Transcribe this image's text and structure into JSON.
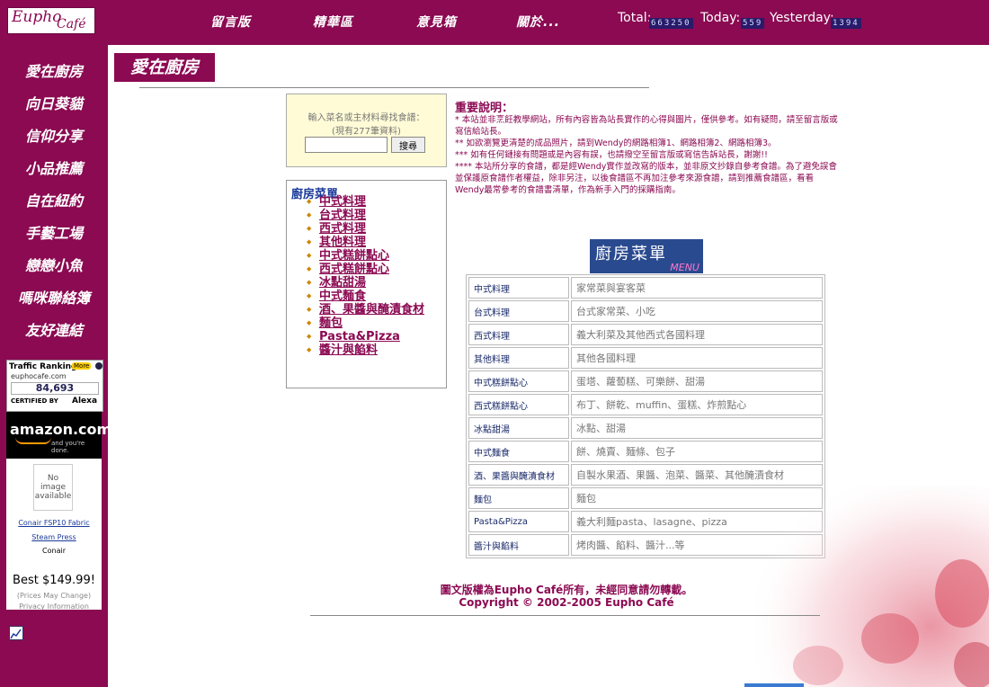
{
  "header": {
    "logo": {
      "line1": "Eupho",
      "line2": "Café"
    },
    "nav": [
      {
        "label": "留言版"
      },
      {
        "label": "精華區"
      },
      {
        "label": "意見箱"
      },
      {
        "label": "關於..."
      }
    ],
    "stats": {
      "total_label": "Total:",
      "total_value": "663250",
      "today_label": "Today:",
      "today_value": "559",
      "yesterday_label": "Yesterday:",
      "yesterday_value": "1394"
    }
  },
  "sidebar": {
    "items": [
      {
        "label": "愛在廚房"
      },
      {
        "label": "向日葵貓"
      },
      {
        "label": "信仰分享"
      },
      {
        "label": "小品推薦"
      },
      {
        "label": "自在紐約"
      },
      {
        "label": "手藝工場"
      },
      {
        "label": "戀戀小魚"
      },
      {
        "label": "嗎咪聯絡簿"
      },
      {
        "label": "友好連結"
      }
    ],
    "traffic": {
      "title": "Traffic Ranking",
      "more": "More",
      "domain": "euphocafe.com",
      "rank": "84,693",
      "certified": "CERTIFIED BY",
      "brand": "Alexa"
    },
    "amazon": {
      "brand": "amazon.com",
      "tagline": "and you're done."
    },
    "product": {
      "noimage": "No image available",
      "name": "Conair FSP10 Fabric Steam Press",
      "maker": "Conair",
      "price": "Best $149.99!",
      "note": "(Prices May Change)",
      "privacy": "Privacy Information"
    }
  },
  "page_title": "愛在廚房",
  "search": {
    "prompt": "輸入菜名或主材料尋找食譜：",
    "count": "(現有277筆資料)",
    "value": "",
    "button": "搜尋"
  },
  "kitchen_menu": {
    "title": "廚房菜單",
    "items": [
      "中式料理",
      "台式料理",
      "西式料理",
      "其他料理",
      "中式糕餅點心",
      "西式糕餅點心",
      "冰點甜湯",
      "中式麵食",
      "酒、果醬與醃漬食材",
      "麵包",
      "Pasta&Pizza",
      "醬汁與餡料"
    ]
  },
  "notice": {
    "title": "重要說明：",
    "p1": "* 本站並非烹飪教學網站，所有內容皆為站長實作的心得與圖片，僅供參考。如有疑問，請至留言版或寫信給站長。",
    "p2": "** 如欲瀏覽更清楚的成品照片，請到Wendy的網路相簿1、網路相簿2、網路相簿3。",
    "p3": "*** 如有任何鏈接有問題或是內容有誤，也請撥空至留言版或寫信告訴站長，謝謝!!",
    "p4": "**** 本站所分享的食譜，都是經Wendy實作並改寫的版本，並非原文抄錄自參考食譜。為了避免誤會並保護原食譜作者權益，除非另注，以後食譜區不再加注參考來源食譜，請到推薦食譜區，看看Wendy最常參考的食譜書清單，作為新手入門的採購指南。"
  },
  "banner": {
    "text": "廚房菜單",
    "sub": "MENU"
  },
  "menu_table": [
    {
      "cat": "中式料理",
      "desc": "家常菜與宴客菜"
    },
    {
      "cat": "台式料理",
      "desc": "台式家常菜、小吃"
    },
    {
      "cat": "西式料理",
      "desc": "義大利菜及其他西式各國料理"
    },
    {
      "cat": "其他料理",
      "desc": "其他各國料理"
    },
    {
      "cat": "中式糕餅點心",
      "desc": "蛋塔、蘿蔔糕、可樂餅、甜湯"
    },
    {
      "cat": "西式糕餅點心",
      "desc": "布丁、餅乾、muffin、蛋糕、炸煎點心"
    },
    {
      "cat": "冰點甜湯",
      "desc": "冰點、甜湯"
    },
    {
      "cat": "中式麵食",
      "desc": "餅、燒賣、麵條、包子"
    },
    {
      "cat": "酒、果醬與醃漬食材",
      "desc": "自製水果酒、果醬、泡菜、醬菜、其他醃漬食材"
    },
    {
      "cat": "麵包",
      "desc": "麵包"
    },
    {
      "cat": "Pasta&Pizza",
      "desc": "義大利麵pasta、lasagne、pizza"
    },
    {
      "cat": "醬汁與餡料",
      "desc": "烤肉醬、餡料、醬汁...等"
    }
  ],
  "footer": {
    "line1": "圖文版權為Eupho Café所有，未經同意請勿轉載。",
    "line2": "Copyright © 2002-2005 Eupho Café"
  },
  "colors": {
    "brand": "#8b0a52",
    "counter_bg": "#2a1a6a",
    "search_bg": "#fffbd6",
    "link": "#1a2a6a"
  }
}
